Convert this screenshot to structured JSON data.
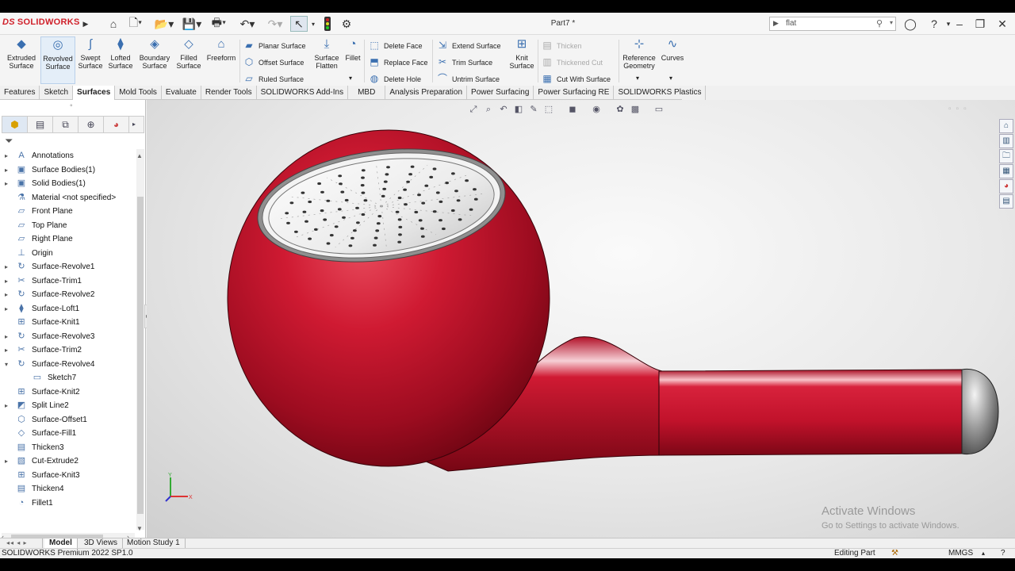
{
  "app": {
    "brand": "SOLIDWORKS",
    "brand_mark": "DS",
    "doc_title": "Part7 *"
  },
  "search": {
    "value": "flat"
  },
  "ribbon": {
    "big": [
      {
        "id": "extruded-surface",
        "label": "Extruded Surface"
      },
      {
        "id": "revolved-surface",
        "label": "Revolved Surface"
      },
      {
        "id": "swept-surface",
        "label": "Swept Surface"
      },
      {
        "id": "lofted-surface",
        "label": "Lofted Surface"
      },
      {
        "id": "boundary-surface",
        "label": "Boundary Surface"
      },
      {
        "id": "filled-surface",
        "label": "Filled Surface"
      },
      {
        "id": "freeform",
        "label": "Freeform"
      }
    ],
    "planar": "Planar Surface",
    "offset": "Offset Surface",
    "ruled": "Ruled Surface",
    "flatten": "Surface Flatten",
    "fillet": "Fillet",
    "delete_face": "Delete Face",
    "replace_face": "Replace Face",
    "delete_hole": "Delete Hole",
    "extend": "Extend Surface",
    "trim": "Trim Surface",
    "untrim": "Untrim Surface",
    "knit": "Knit Surface",
    "thicken": "Thicken",
    "thickened_cut": "Thickened Cut",
    "cut_with_surface": "Cut With Surface",
    "reference_geometry": "Reference Geometry",
    "curves": "Curves"
  },
  "tabs": [
    "Features",
    "Sketch",
    "Surfaces",
    "Mold Tools",
    "Evaluate",
    "Render Tools",
    "SOLIDWORKS Add-Ins",
    "MBD",
    "Analysis Preparation",
    "Power Surfacing",
    "Power Surfacing RE",
    "SOLIDWORKS Plastics"
  ],
  "active_tab": "Surfaces",
  "tree": [
    {
      "label": "Annotations",
      "icon": "annotation-icon",
      "expand": true,
      "indent": 0
    },
    {
      "label": "Surface Bodies(1)",
      "icon": "folder-icon",
      "expand": true,
      "indent": 0
    },
    {
      "label": "Solid Bodies(1)",
      "icon": "folder-icon",
      "expand": true,
      "indent": 0
    },
    {
      "label": "Material <not specified>",
      "icon": "material-icon",
      "expand": false,
      "indent": 0
    },
    {
      "label": "Front Plane",
      "icon": "plane-icon",
      "expand": false,
      "indent": 0
    },
    {
      "label": "Top Plane",
      "icon": "plane-icon",
      "expand": false,
      "indent": 0
    },
    {
      "label": "Right Plane",
      "icon": "plane-icon",
      "expand": false,
      "indent": 0
    },
    {
      "label": "Origin",
      "icon": "origin-icon",
      "expand": false,
      "indent": 0
    },
    {
      "label": "Surface-Revolve1",
      "icon": "revolve-icon",
      "expand": true,
      "indent": 0
    },
    {
      "label": "Surface-Trim1",
      "icon": "trim-icon",
      "expand": true,
      "indent": 0
    },
    {
      "label": "Surface-Revolve2",
      "icon": "revolve-icon",
      "expand": true,
      "indent": 0
    },
    {
      "label": "Surface-Loft1",
      "icon": "loft-icon",
      "expand": true,
      "indent": 0
    },
    {
      "label": "Surface-Knit1",
      "icon": "knit-icon",
      "expand": false,
      "indent": 0
    },
    {
      "label": "Surface-Revolve3",
      "icon": "revolve-icon",
      "expand": true,
      "indent": 0
    },
    {
      "label": "Surface-Trim2",
      "icon": "trim-icon",
      "expand": true,
      "indent": 0
    },
    {
      "label": "Surface-Revolve4",
      "icon": "revolve-icon",
      "expand": true,
      "expanded": true,
      "indent": 0
    },
    {
      "label": "Sketch7",
      "icon": "sketch-icon",
      "expand": false,
      "indent": 1
    },
    {
      "label": "Surface-Knit2",
      "icon": "knit-icon",
      "expand": false,
      "indent": 0
    },
    {
      "label": "Split Line2",
      "icon": "splitline-icon",
      "expand": true,
      "indent": 0
    },
    {
      "label": "Surface-Offset1",
      "icon": "offset-icon",
      "expand": false,
      "indent": 0
    },
    {
      "label": "Surface-Fill1",
      "icon": "fill-icon",
      "expand": false,
      "indent": 0
    },
    {
      "label": "Thicken3",
      "icon": "thicken-icon",
      "expand": false,
      "indent": 0
    },
    {
      "label": "Cut-Extrude2",
      "icon": "cut-icon",
      "expand": true,
      "indent": 0
    },
    {
      "label": "Surface-Knit3",
      "icon": "knit-icon",
      "expand": false,
      "indent": 0
    },
    {
      "label": "Thicken4",
      "icon": "thicken-icon",
      "expand": false,
      "indent": 0
    },
    {
      "label": "Fillet1",
      "icon": "fillet-icon",
      "expand": false,
      "indent": 0
    }
  ],
  "bottom_tabs": [
    "Model",
    "3D Views",
    "Motion Study 1"
  ],
  "status": {
    "version": "SOLIDWORKS Premium 2022 SP1.0",
    "mode": "Editing Part",
    "units": "MMGS"
  },
  "watermark": {
    "line1": "Activate Windows",
    "line2": "Go to Settings to activate Windows."
  },
  "colors": {
    "brand": "#d0202a",
    "model_red": "#c8102e",
    "accent": "#3a6fb0"
  }
}
